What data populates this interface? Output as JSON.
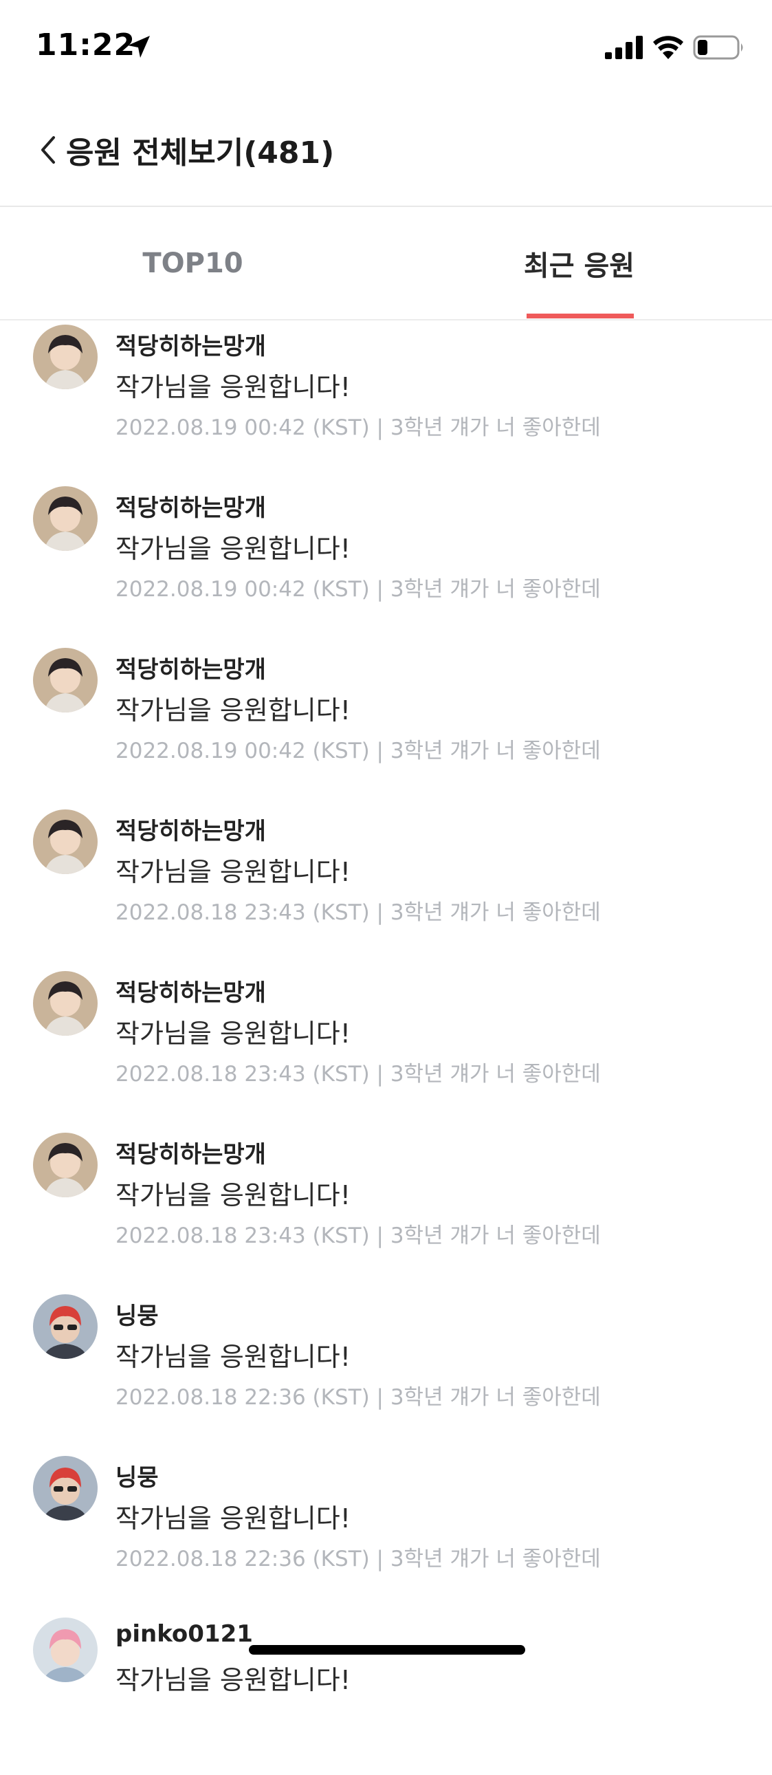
{
  "status_bar": {
    "time": "11:22",
    "icons": [
      "location-arrow-icon",
      "cellular-signal-icon",
      "wifi-icon",
      "battery-icon"
    ]
  },
  "header": {
    "back_icon": "chevron-left-icon",
    "title": "응원 전체보기(481)"
  },
  "tabs": [
    {
      "label": "TOP10",
      "selected": false
    },
    {
      "label": "최근 응원",
      "selected": true
    }
  ],
  "colors": {
    "accent": "#ef5a5a",
    "inactive_tab": "#7e8187",
    "meta_text": "#b3b6bb"
  },
  "list": [
    {
      "nickname": "적당히하는망개",
      "message": "작가님을 응원합니다!",
      "meta": "2022.08.19 00:42 (KST) | 3학년 걔가 너 좋아한데",
      "avatar": "avatar-a"
    },
    {
      "nickname": "적당히하는망개",
      "message": "작가님을 응원합니다!",
      "meta": "2022.08.19 00:42 (KST) | 3학년 걔가 너 좋아한데",
      "avatar": "avatar-a"
    },
    {
      "nickname": "적당히하는망개",
      "message": "작가님을 응원합니다!",
      "meta": "2022.08.19 00:42 (KST) | 3학년 걔가 너 좋아한데",
      "avatar": "avatar-a"
    },
    {
      "nickname": "적당히하는망개",
      "message": "작가님을 응원합니다!",
      "meta": "2022.08.18 23:43 (KST) | 3학년 걔가 너 좋아한데",
      "avatar": "avatar-a"
    },
    {
      "nickname": "적당히하는망개",
      "message": "작가님을 응원합니다!",
      "meta": "2022.08.18 23:43 (KST) | 3학년 걔가 너 좋아한데",
      "avatar": "avatar-a"
    },
    {
      "nickname": "적당히하는망개",
      "message": "작가님을 응원합니다!",
      "meta": "2022.08.18 23:43 (KST) | 3학년 걔가 너 좋아한데",
      "avatar": "avatar-a"
    },
    {
      "nickname": "닝뭉",
      "message": "작가님을 응원합니다!",
      "meta": "2022.08.18 22:36 (KST) | 3학년 걔가 너 좋아한데",
      "avatar": "avatar-b"
    },
    {
      "nickname": "닝뭉",
      "message": "작가님을 응원합니다!",
      "meta": "2022.08.18 22:36 (KST) | 3학년 걔가 너 좋아한데",
      "avatar": "avatar-b"
    },
    {
      "nickname": "pinko0121",
      "message": "작가님을 응원합니다!",
      "meta": "",
      "avatar": "avatar-c"
    }
  ]
}
